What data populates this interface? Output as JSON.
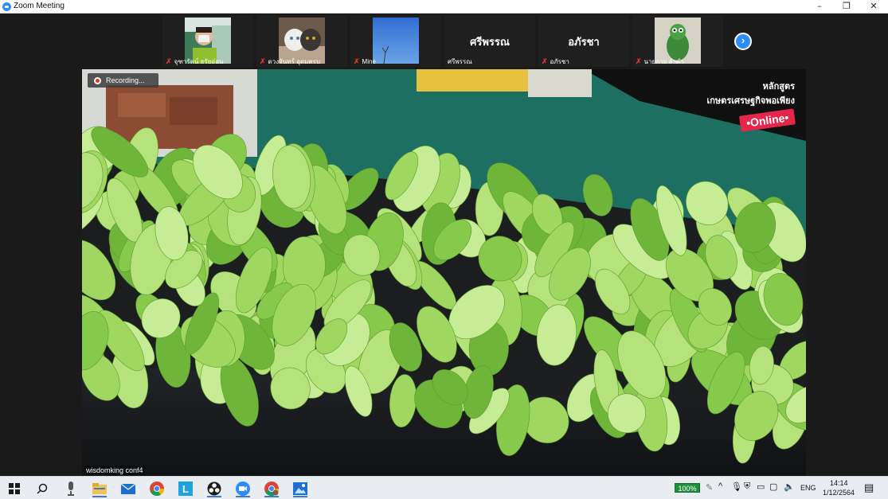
{
  "window": {
    "title": "Zoom Meeting",
    "minimize": "–",
    "restore": "❐",
    "close": "✕"
  },
  "participants": [
    {
      "name": "จุฑารัตน์ ธรัยอ่อน",
      "muted": true,
      "type": "video"
    },
    {
      "name": "ดวงจันทร์ อุดมตรบ",
      "muted": true,
      "type": "video"
    },
    {
      "name": "Mine",
      "muted": true,
      "type": "video"
    },
    {
      "name": "ศรีพรรณ",
      "display": "ศรีพรรณ",
      "muted": false,
      "type": "name"
    },
    {
      "name": "อภัรชา",
      "display": "อภัรชา",
      "muted": true,
      "type": "name"
    },
    {
      "name": "นายกาย ลำดำ",
      "muted": true,
      "type": "video"
    }
  ],
  "next_page_icon": "chevron-right-icon",
  "main_video": {
    "recording_label": "Recording...",
    "overlay_line1": "หลักสูตร",
    "overlay_line2": "เกษตรเศรษฐกิจพอเพียง",
    "overlay_badge": "•Online•",
    "speaker_name": "wisdomking conf4"
  },
  "taskbar": {
    "icons": [
      "windows-start-icon",
      "search-icon",
      "microphone-icon",
      "file-explorer-icon",
      "mail-icon",
      "chrome-icon",
      "line-app-icon",
      "obs-icon",
      "zoom-icon",
      "chrome-profile-icon",
      "photos-icon"
    ],
    "battery": "100%",
    "language": "ENG",
    "time": "14:14",
    "date": "1/12/2564"
  },
  "colors": {
    "accent": "#2d8cff",
    "mute": "#e0342e",
    "badge": "#e4264a"
  }
}
